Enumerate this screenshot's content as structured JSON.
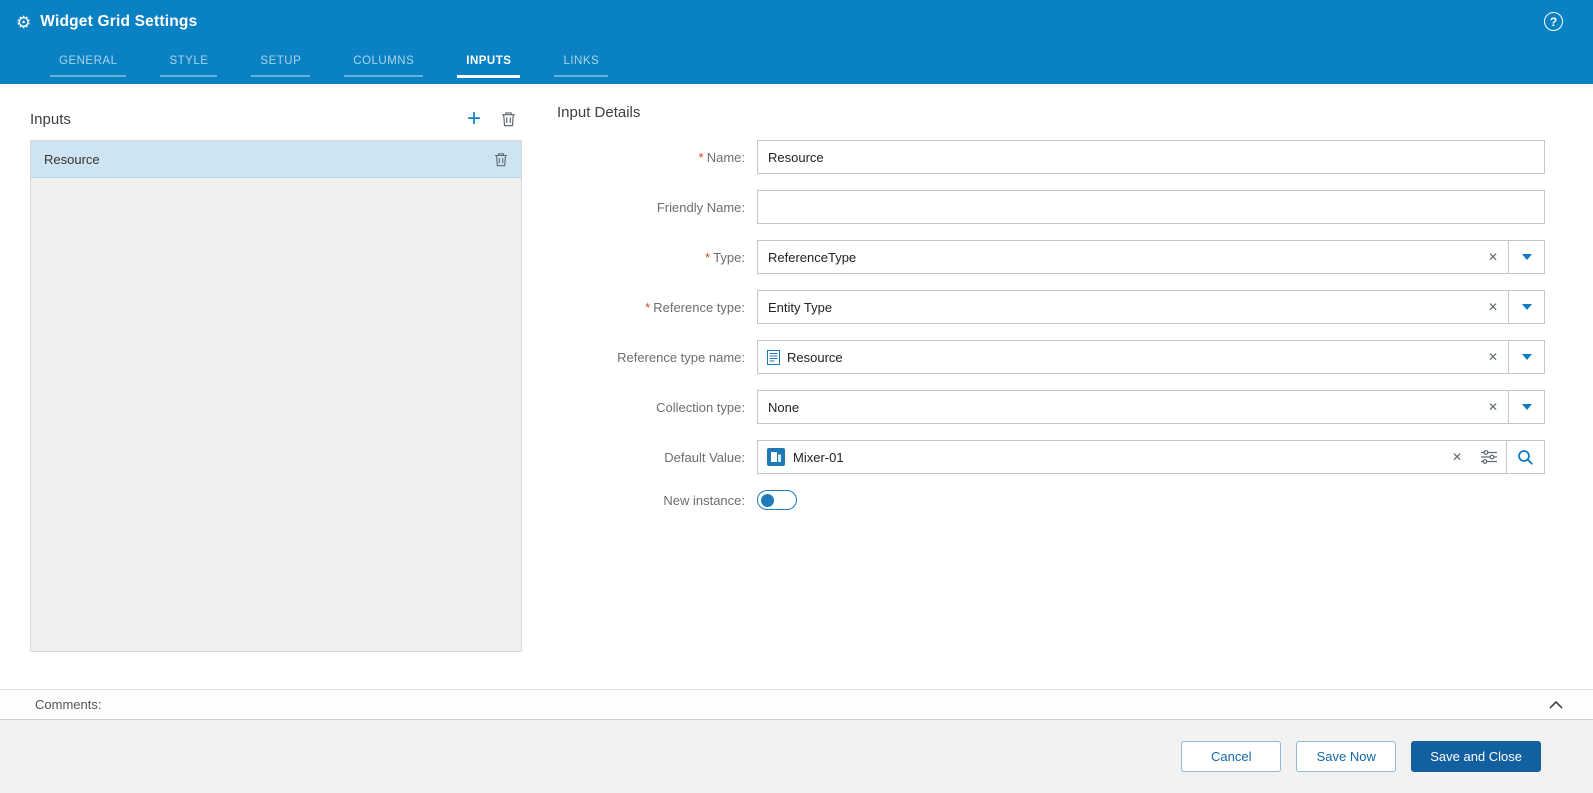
{
  "header": {
    "title": "Widget Grid Settings",
    "tabs": [
      {
        "label": "GENERAL"
      },
      {
        "label": "STYLE"
      },
      {
        "label": "SETUP"
      },
      {
        "label": "COLUMNS"
      },
      {
        "label": "INPUTS"
      },
      {
        "label": "LINKS"
      }
    ],
    "active_tab": "INPUTS"
  },
  "icons": {
    "gear": "⚙",
    "help": "?",
    "add": "+",
    "clear": "✕",
    "trash": "trash-icon",
    "caret_down": "chevron-down-icon",
    "document": "entity-document-icon",
    "thing": "thing-entity-icon",
    "filter": "filter-sliders-icon",
    "search": "magnifier-icon",
    "chevron_up": "chevron-up-icon"
  },
  "inputs_panel": {
    "title": "Inputs",
    "items": [
      {
        "label": "Resource",
        "selected": true
      }
    ]
  },
  "details_panel": {
    "title": "Input Details",
    "name": {
      "label": "Name:",
      "required": "*",
      "value": "Resource"
    },
    "friendly_name": {
      "label": "Friendly Name:",
      "value": "",
      "placeholder": ""
    },
    "type": {
      "label": "Type:",
      "required": "*",
      "value": "ReferenceType"
    },
    "reference_type": {
      "label": "Reference type:",
      "required": "*",
      "value": "Entity Type"
    },
    "reference_type_name": {
      "label": "Reference type name:",
      "value": "Resource"
    },
    "collection_type": {
      "label": "Collection type:",
      "value": "None"
    },
    "default_value": {
      "label": "Default Value:",
      "value": "Mixer-01"
    },
    "new_instance": {
      "label": "New instance:",
      "state": "off"
    }
  },
  "comments": {
    "label": "Comments:"
  },
  "footer": {
    "cancel_label": "Cancel",
    "save_now_label": "Save Now",
    "save_and_close_label": "Save and Close"
  },
  "colors": {
    "header_blue": "#0a81c2",
    "accent_blue": "#0f7cbf",
    "primary_button_blue": "#12609f",
    "selected_item_blue": "#cfe4f3",
    "required_marker": "#ce4a21"
  }
}
